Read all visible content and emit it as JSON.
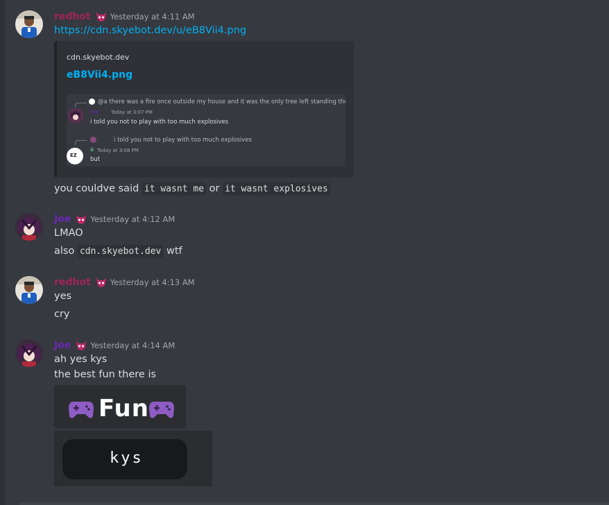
{
  "messages": [
    {
      "user": "redhot",
      "timestamp": "Yesterday at 4:11 AM",
      "link": "https://cdn.skyebot.dev/u/eB8Vii4.png",
      "embed": {
        "provider": "cdn.skyebot.dev",
        "title": "eB8Vii4.png",
        "image": {
          "reply1_text": "@a there was a fire once outside my house and it was the only tree left standing there",
          "msg1_user": "Joe",
          "msg1_time": "Today at 3:07 PM",
          "msg1_text": "i told you not to play with too much explosives",
          "reply2_text": "i told you not to play with too much explosives",
          "msg2_user": "a",
          "msg2_time": "Today at 3:08 PM",
          "msg2_text": "but",
          "avatar_ez": "EZ"
        }
      },
      "after_text_1": "you couldve said ",
      "code_1": "it wasnt me",
      "after_text_2": " or ",
      "code_2": "it wasnt explosives"
    },
    {
      "user": "Joe",
      "timestamp": "Yesterday at 4:12 AM",
      "line1": "LMAO",
      "line2_pre": "also ",
      "line2_code": "cdn.skyebot.dev",
      "line2_post": " wtf"
    },
    {
      "user": "redhot",
      "timestamp": "Yesterday at 4:13 AM",
      "line1": "yes",
      "line2": "cry"
    },
    {
      "user": "Joe",
      "timestamp": "Yesterday at 4:14 AM",
      "line1": "ah yes kys",
      "line2": "the best fun there is",
      "tile1": "Fun",
      "tile2": "kys"
    }
  ],
  "colors": {
    "background": "#36393f",
    "redhot_name": "#a0245a",
    "joe_name": "#6a27b3",
    "link": "#00b0f4",
    "role_icon": "#c0286a"
  }
}
